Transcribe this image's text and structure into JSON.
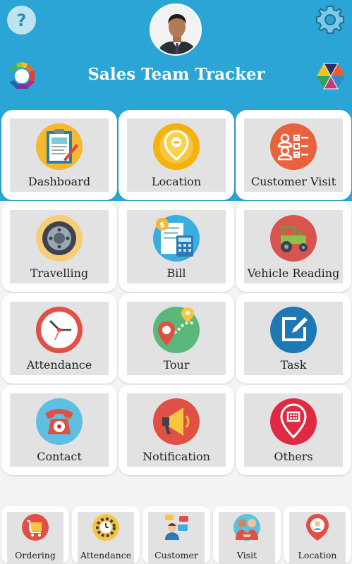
{
  "app": {
    "title": "Sales Team Tracker",
    "help_label": "?"
  },
  "colors": {
    "header": "#2aa5d6",
    "card": "#ffffff",
    "tile": "#e2e2e2"
  },
  "menu": [
    {
      "label": "Dashboard",
      "icon": "clipboard-icon"
    },
    {
      "label": "Location",
      "icon": "location-pin-icon"
    },
    {
      "label": "Customer Visit",
      "icon": "customer-visit-icon"
    },
    {
      "label": "Travelling",
      "icon": "wheel-icon"
    },
    {
      "label": "Bill",
      "icon": "bill-calculator-icon"
    },
    {
      "label": "Vehicle Reading",
      "icon": "tractor-icon"
    },
    {
      "label": "Attendance",
      "icon": "clock-icon"
    },
    {
      "label": "Tour",
      "icon": "map-route-icon"
    },
    {
      "label": "Task",
      "icon": "edit-task-icon"
    },
    {
      "label": "Contact",
      "icon": "telephone-icon"
    },
    {
      "label": "Notification",
      "icon": "megaphone-icon"
    },
    {
      "label": "Others",
      "icon": "others-pin-icon"
    }
  ],
  "bottom_nav": [
    {
      "label": "Ordering",
      "icon": "cart-icon"
    },
    {
      "label": "Attendance",
      "icon": "gear-clock-icon"
    },
    {
      "label": "Customer",
      "icon": "customer-chat-icon"
    },
    {
      "label": "Visit",
      "icon": "handshake-icon"
    },
    {
      "label": "Location",
      "icon": "person-pin-icon"
    }
  ]
}
